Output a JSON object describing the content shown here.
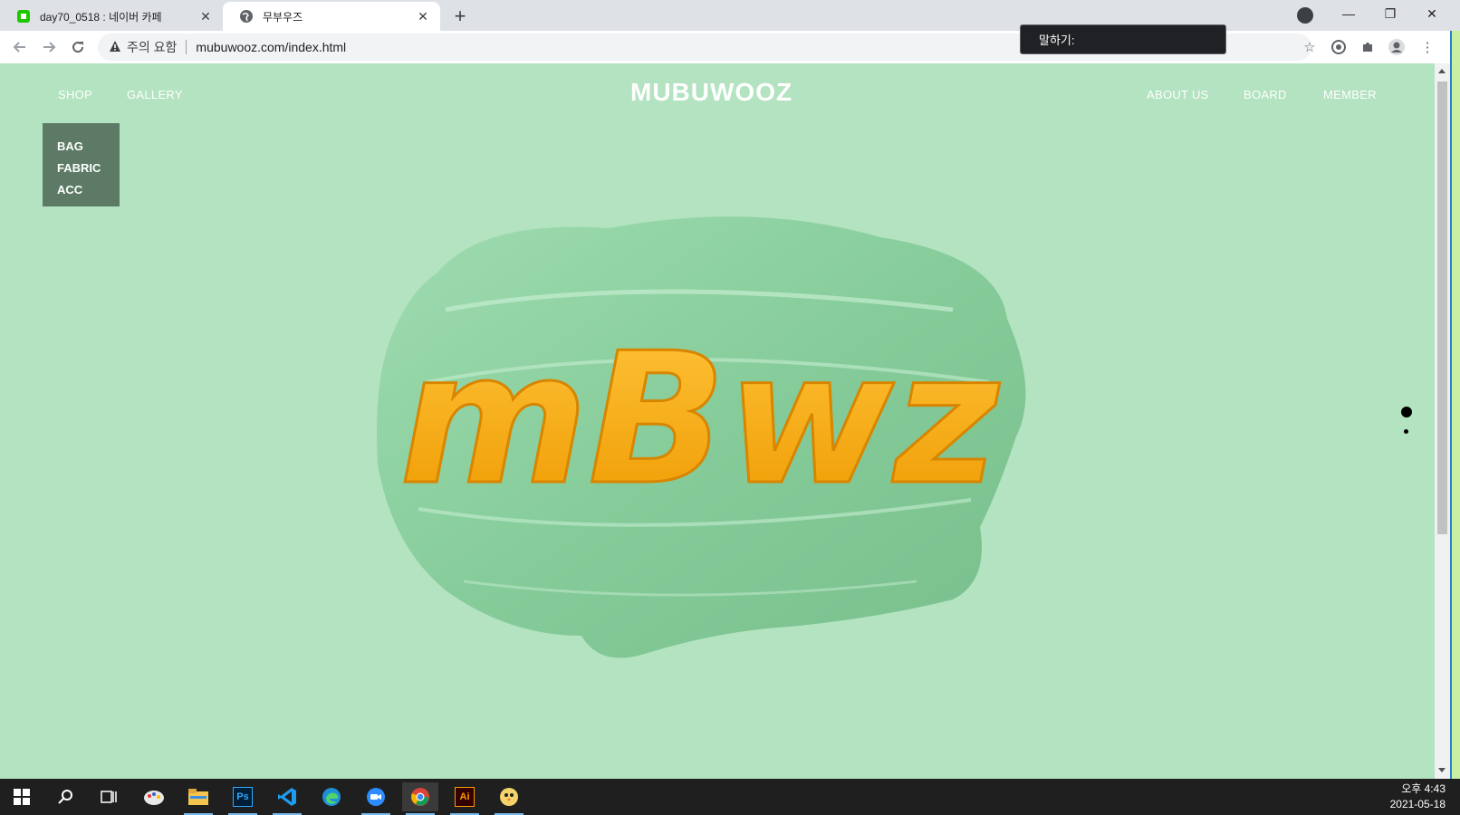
{
  "browser": {
    "tabs": [
      {
        "title": "day70_0518 : 네이버 카페",
        "active": false,
        "favicon": "naver-cafe-icon"
      },
      {
        "title": "무부우즈",
        "active": true,
        "favicon": "globe-icon"
      }
    ],
    "new_tab_symbol": "+",
    "security_label": "주의 요함",
    "url": "mubuwooz.com/index.html",
    "tooltip": "말하기:"
  },
  "site": {
    "logo": "MUBUWOOZ",
    "nav_left": [
      "SHOP",
      "GALLERY"
    ],
    "nav_right": [
      "ABOUT US",
      "BOARD",
      "MEMBER"
    ],
    "dropdown": [
      "BAG",
      "FABRIC",
      "ACC"
    ],
    "hero_text": "mBwz",
    "colors": {
      "page_bg": "#b3e3c0",
      "paint": "#8fd3a5",
      "letters": "#f4a912",
      "dropdown_bg": "#5c7a65"
    }
  },
  "taskbar": {
    "apps": [
      "windows-start-icon",
      "search-icon",
      "task-view-icon",
      "paint-icon",
      "file-explorer-icon",
      "photoshop-icon",
      "vscode-icon",
      "edge-icon",
      "zoom-icon",
      "chrome-icon",
      "illustrator-icon",
      "bird-app-icon"
    ],
    "ps_label": "Ps",
    "ai_label": "Ai",
    "time": "오후 4:43",
    "date": "2021-05-18"
  }
}
